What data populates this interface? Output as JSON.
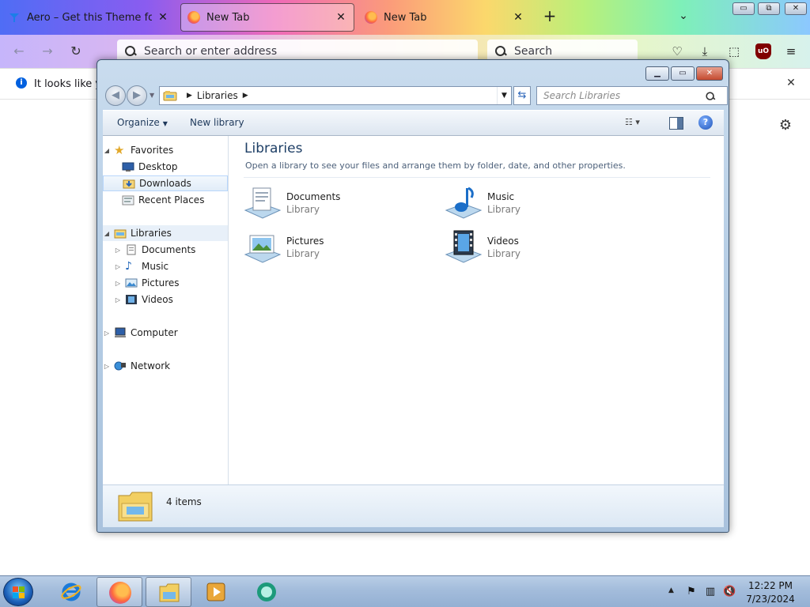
{
  "firefox": {
    "tabs": [
      {
        "label": "Aero – Get this Theme for 🦊 Fi",
        "icon": "theme-icon",
        "active": false
      },
      {
        "label": "New Tab",
        "icon": "firefox-icon",
        "active": true
      },
      {
        "label": "New Tab",
        "icon": "firefox-icon",
        "active": false
      }
    ],
    "new_tab_glyph": "+",
    "tab_list_glyph": "⌄",
    "window_controls": {
      "minimize": "▭",
      "restore": "⧉",
      "close": "✕"
    },
    "address_placeholder": "Search or enter address",
    "search_placeholder": "Search",
    "toolbar_icons": [
      "pocket-icon",
      "download-icon",
      "extensions-icon",
      "ublock-icon",
      "menu-icon"
    ],
    "notification_text": "It looks like you",
    "accent_color": "#0060df"
  },
  "explorer": {
    "breadcrumb": [
      "Libraries"
    ],
    "search_placeholder": "Search Libraries",
    "commands": {
      "organize": "Organize",
      "new_library": "New library"
    },
    "nav_tree": {
      "favorites": {
        "label": "Favorites",
        "items": [
          "Desktop",
          "Downloads",
          "Recent Places"
        ]
      },
      "libraries": {
        "label": "Libraries",
        "items": [
          "Documents",
          "Music",
          "Pictures",
          "Videos"
        ]
      },
      "computer": "Computer",
      "network": "Network"
    },
    "content": {
      "title": "Libraries",
      "subtitle": "Open a library to see your files and arrange them by folder, date, and other properties.",
      "libraries": [
        {
          "name": "Documents",
          "type": "Library",
          "icon": "documents-library-icon"
        },
        {
          "name": "Music",
          "type": "Library",
          "icon": "music-library-icon"
        },
        {
          "name": "Pictures",
          "type": "Library",
          "icon": "pictures-library-icon"
        },
        {
          "name": "Videos",
          "type": "Library",
          "icon": "videos-library-icon"
        }
      ]
    },
    "status": {
      "item_count": "4 items"
    },
    "title_color": "#1e3f66"
  },
  "taskbar": {
    "apps": [
      {
        "name": "internet-explorer-icon",
        "running": false
      },
      {
        "name": "firefox-icon",
        "running": true
      },
      {
        "name": "file-explorer-icon",
        "running": true
      },
      {
        "name": "media-player-icon",
        "running": false
      },
      {
        "name": "app-icon",
        "running": false
      }
    ],
    "time": "12:22 PM",
    "date": "7/23/2024"
  }
}
